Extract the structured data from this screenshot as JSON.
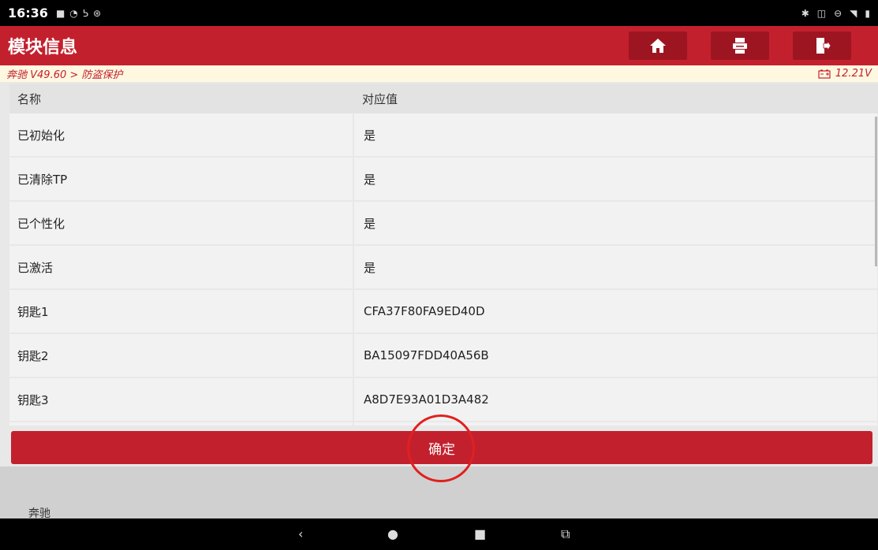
{
  "status": {
    "time": "16:36",
    "left_icons": [
      "message-icon",
      "wifi-icon",
      "vpn-icon",
      "settings-icon"
    ],
    "right_icons": [
      "bluetooth-icon",
      "vibrate-icon",
      "dnd-icon",
      "signal-icon",
      "battery-icon"
    ]
  },
  "header": {
    "title": "模块信息",
    "buttons": [
      "home-icon",
      "print-icon",
      "exit-icon"
    ]
  },
  "breadcrumb": {
    "path": "奔驰 V49.60 > 防盗保护",
    "voltage": "12.21V"
  },
  "table": {
    "headers": [
      "名称",
      "对应值"
    ],
    "rows": [
      {
        "name": "已初始化",
        "value": "是"
      },
      {
        "name": "已清除TP",
        "value": "是"
      },
      {
        "name": "已个性化",
        "value": "是"
      },
      {
        "name": "已激活",
        "value": "是"
      },
      {
        "name": "钥匙1",
        "value": "CFA37F80FA9ED40D"
      },
      {
        "name": "钥匙2",
        "value": "BA15097FDD40A56B"
      },
      {
        "name": "钥匙3",
        "value": "A8D7E93A01D3A482"
      },
      {
        "name": "",
        "value": ""
      }
    ]
  },
  "confirm_label": "确定",
  "footer_label": "奔驰",
  "colors": {
    "brand_red": "#c3202e",
    "header_button": "#9e1522",
    "highlight_ring": "#e02020"
  },
  "nav": [
    "back-icon",
    "home-icon",
    "recents-icon",
    "screenshot-icon"
  ]
}
